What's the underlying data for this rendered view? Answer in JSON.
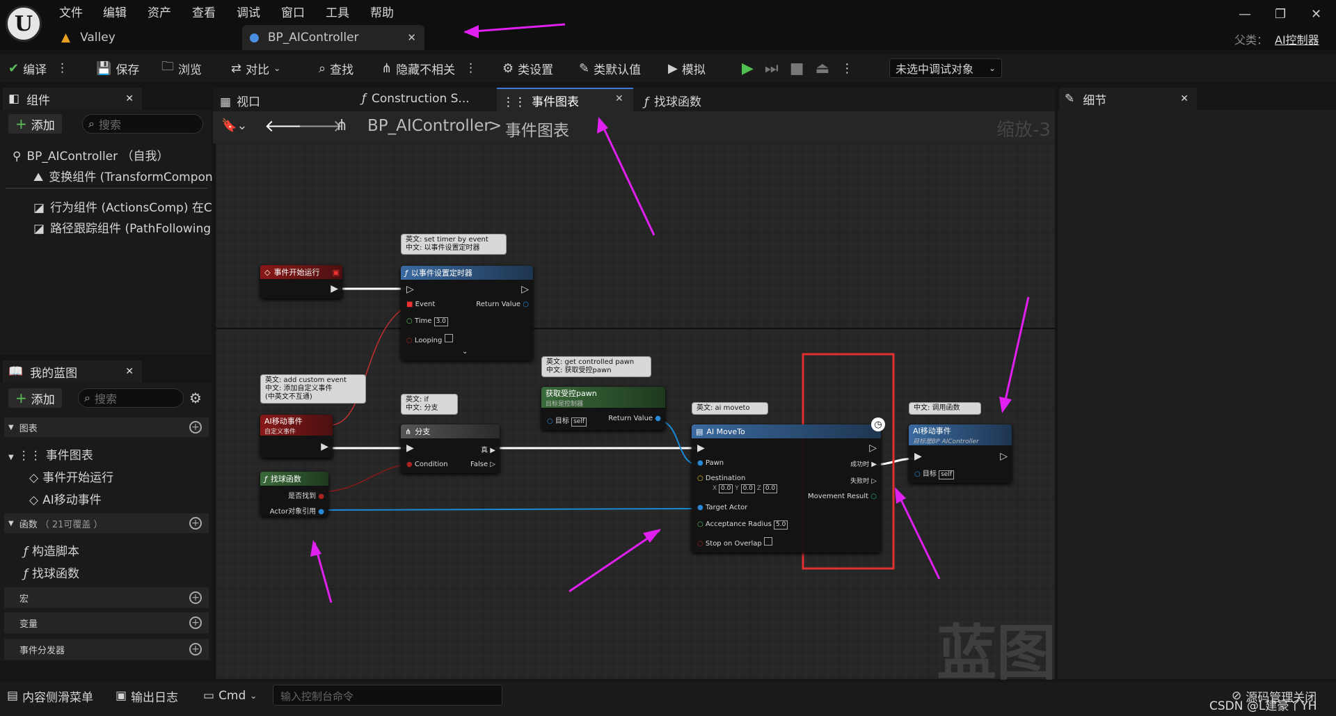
{
  "menu": [
    "文件",
    "编辑",
    "资产",
    "查看",
    "调试",
    "窗口",
    "工具",
    "帮助"
  ],
  "tabs": {
    "valley": "Valley",
    "blueprint": "BP_AIController"
  },
  "parent": {
    "label": "父类：",
    "value": "AI控制器"
  },
  "toolbar": {
    "compile": "编译",
    "save": "保存",
    "browse": "浏览",
    "diff": "对比",
    "find": "查找",
    "hide": "隐藏不相关",
    "class_settings": "类设置",
    "class_defaults": "类默认值",
    "simulate": "模拟",
    "debug_target": "未选中调试对象"
  },
  "components": {
    "title": "组件",
    "add": "添加",
    "search_placeholder": "搜索",
    "items": [
      "BP_AIController （自我）",
      "变换组件 (TransformCompon",
      "行为组件 (ActionsComp)  在C",
      "路径跟踪组件 (PathFollowing"
    ]
  },
  "mybp": {
    "title": "我的蓝图",
    "add": "添加",
    "search_placeholder": "搜索",
    "graphs": "图表",
    "event_graph": "事件图表",
    "event_begin": "事件开始运行",
    "ai_move_event": "AI移动事件",
    "functions": "函数",
    "functions_count": "（ 21可覆盖 ）",
    "construct": "构造脚本",
    "find_ball": "找球函数",
    "macros": "宏",
    "variables": "变量",
    "dispatchers": "事件分发器"
  },
  "doctabs": {
    "viewport": "视口",
    "construction": "Construction S...",
    "event_graph": "事件图表",
    "find_ball": "找球函数"
  },
  "details": {
    "title": "细节"
  },
  "breadcrumb": {
    "root": "BP_AIController",
    "sep": ">",
    "current": "事件图表",
    "zoom": "缩放-3"
  },
  "watermark": "蓝图",
  "nodes": {
    "begin": {
      "title": "事件开始运行"
    },
    "timer": {
      "title": "以事件设置定时器",
      "comment": [
        "英文: set timer by event",
        "中文: 以事件设置定时器"
      ],
      "event": "Event",
      "return": "Return Value",
      "time": "Time",
      "time_val": "3.0",
      "looping": "Looping"
    },
    "custom": {
      "title": "AI移动事件",
      "subtitle": "自定义事件",
      "comment": [
        "英文:  add custom event",
        "中文: 添加自定义事件",
        "(中英文不互通)"
      ]
    },
    "branch": {
      "title": "分支",
      "comment": [
        "英文: if",
        "中文: 分支"
      ],
      "condition": "Condition",
      "true": "真",
      "false": "False"
    },
    "getpawn": {
      "title": "获取受控pawn",
      "subtitle": "目标是控制器",
      "comment": [
        "英文: get controlled pawn",
        "中文: 获取受控pawn"
      ],
      "target": "目标",
      "self": "self",
      "return": "Return Value"
    },
    "findfn": {
      "title": "找球函数",
      "found": "是否找到",
      "actor": "Actor对象引用"
    },
    "moveto": {
      "title": "AI MoveTo",
      "comment": "英文: ai moveto",
      "pawn": "Pawn",
      "dest": "Destination",
      "x": "0.0",
      "y": "0.0",
      "z": "0.0",
      "target": "Target Actor",
      "radius": "Acceptance Radius",
      "radius_val": "5.0",
      "overlap": "Stop on Overlap",
      "success": "成功时",
      "fail": "失败时",
      "result": "Movement Result"
    },
    "call": {
      "title": "AI移动事件",
      "subtitle": "目标是BP AIController",
      "comment": "中文: 调用函数",
      "target": "目标",
      "self": "self"
    }
  },
  "bottom": {
    "drawer": "内容侧滑菜单",
    "log": "输出日志",
    "cmd": "Cmd",
    "cmd_placeholder": "输入控制台命令",
    "scm": "源码管理关闭",
    "credit": "CSDN @L建豪丫YH"
  }
}
